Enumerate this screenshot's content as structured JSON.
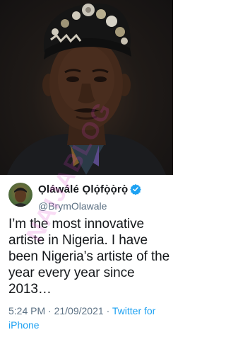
{
  "tweet": {
    "display_name": "Ọláwálé Ọlọ́fọ̀ọ̀rọ̀",
    "handle": "@BrymOlawale",
    "text": "I’m the most innovative artiste in Nigeria. I have been Nigeria’s artiste of the year every year since 2013…",
    "time": "5:24 PM",
    "date": "21/09/2021",
    "source": "Twitter for iPhone",
    "separator": "·"
  },
  "watermark": "NAIJABLOG",
  "icons": {
    "verified": "verified-badge-icon"
  },
  "colors": {
    "verified": "#1da1f2",
    "link": "#1da1f2",
    "meta": "#5b7083",
    "text": "#14171a"
  }
}
